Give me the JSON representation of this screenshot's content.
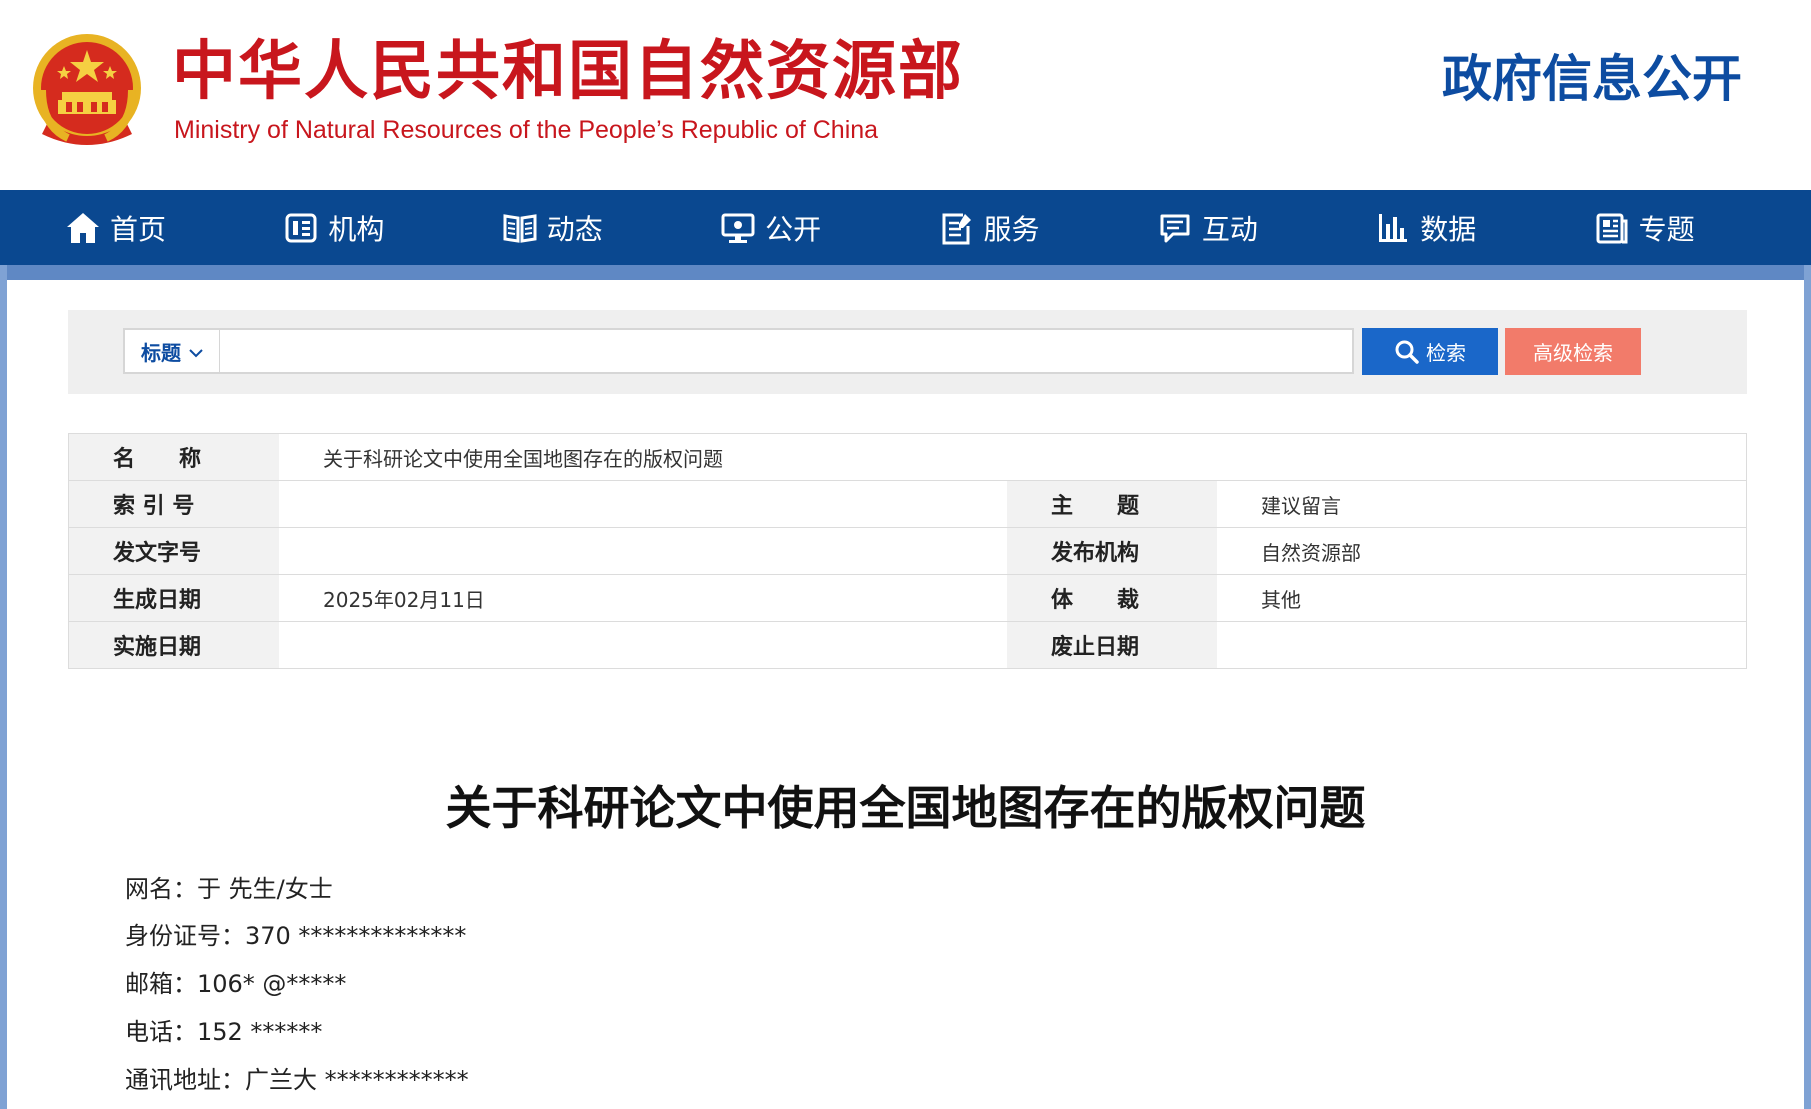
{
  "header": {
    "site_name_cn": "中华人民共和国自然资源部",
    "site_name_en": "Ministry of Natural Resources of the People’s Republic of China",
    "section": "政府信息公开"
  },
  "nav": {
    "items": [
      {
        "label": "首页",
        "icon": "home-icon"
      },
      {
        "label": "机构",
        "icon": "org-icon"
      },
      {
        "label": "动态",
        "icon": "book-icon"
      },
      {
        "label": "公开",
        "icon": "monitor-icon"
      },
      {
        "label": "服务",
        "icon": "edit-doc-icon"
      },
      {
        "label": "互动",
        "icon": "chat-icon"
      },
      {
        "label": "数据",
        "icon": "bar-chart-icon"
      },
      {
        "label": "专题",
        "icon": "newspaper-icon"
      }
    ]
  },
  "search": {
    "field_selected": "标题",
    "query": "",
    "search_label": "检索",
    "advanced_label": "高级检索"
  },
  "info": {
    "name_label": "名　　称",
    "name_value": "关于科研论文中使用全国地图存在的版权问题",
    "index_label": "索 引 号",
    "index_value": "",
    "topic_label": "主　　题",
    "topic_value": "建议留言",
    "docno_label": "发文字号",
    "docno_value": "",
    "publisher_label": "发布机构",
    "publisher_value": "自然资源部",
    "created_label": "生成日期",
    "created_value": "2025年02月11日",
    "genre_label": "体　　裁",
    "genre_value": "其他",
    "effective_label": "实施日期",
    "effective_value": "",
    "abolished_label": "废止日期",
    "abolished_value": ""
  },
  "article": {
    "title": "关于科研论文中使用全国地图存在的版权问题",
    "netname": "网名：于 先生/女士",
    "id_number": "身份证号：370 **************",
    "email": "邮箱：106* @*****",
    "phone": "电话：152 ******",
    "address": "通讯地址：广兰大 ************"
  },
  "colors": {
    "brand_red": "#c8161d",
    "nav_blue": "#0a4890",
    "search_blue": "#1a67c9",
    "advanced_salmon": "#f27b6a"
  }
}
